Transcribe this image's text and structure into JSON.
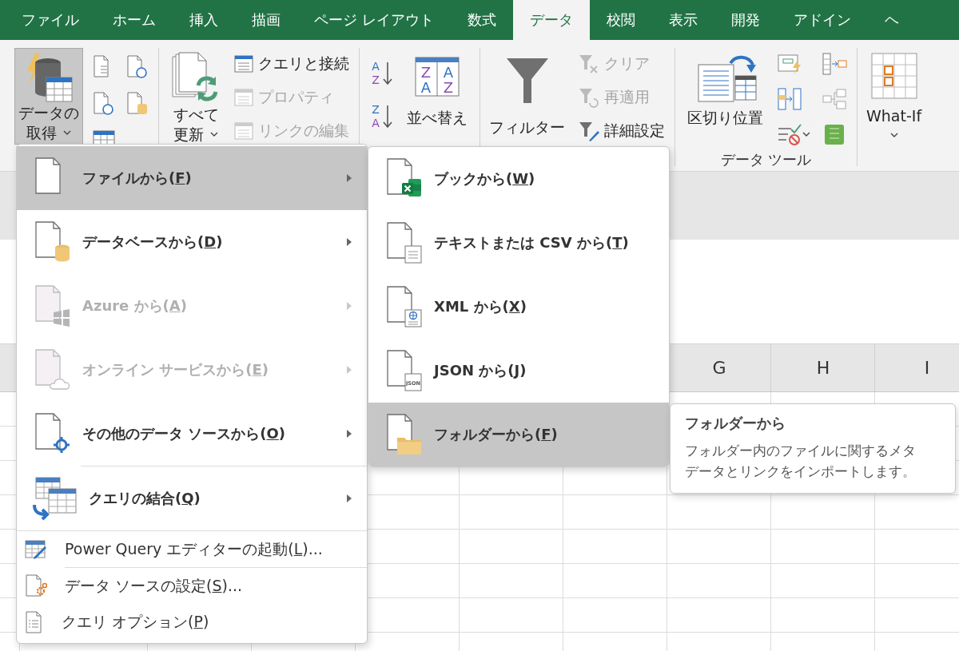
{
  "tabs": [
    {
      "label": "ファイル",
      "selected": false
    },
    {
      "label": "ホーム",
      "selected": false
    },
    {
      "label": "挿入",
      "selected": false
    },
    {
      "label": "描画",
      "selected": false
    },
    {
      "label": "ページ レイアウト",
      "selected": false
    },
    {
      "label": "数式",
      "selected": false
    },
    {
      "label": "データ",
      "selected": true
    },
    {
      "label": "校閲",
      "selected": false
    },
    {
      "label": "表示",
      "selected": false
    },
    {
      "label": "開発",
      "selected": false
    },
    {
      "label": "アドイン",
      "selected": false
    },
    {
      "label": "ヘ",
      "selected": false
    }
  ],
  "ribbon": {
    "get_data": {
      "label_lines": [
        "データの",
        "取得"
      ],
      "pressed": true
    },
    "refresh_all": {
      "label_lines": [
        "すべて",
        "更新"
      ],
      "pressed": false
    },
    "queries": [
      {
        "label": "クエリと接続",
        "disabled": false
      },
      {
        "label": "プロパティ",
        "disabled": true
      },
      {
        "label": "リンクの編集",
        "disabled": true
      }
    ],
    "sort_icons": [
      {
        "top": "A",
        "bottom": "Z"
      },
      {
        "top": "Z",
        "bottom": "A"
      }
    ],
    "sort_grid": [
      "Z",
      "A",
      "A",
      "Z"
    ],
    "sort": {
      "label": "並べ替え"
    },
    "filter": {
      "label": "フィルター"
    },
    "filter_options": [
      {
        "label": "クリア",
        "disabled": true
      },
      {
        "label": "再適用",
        "disabled": true
      },
      {
        "label": "詳細設定",
        "disabled": false
      }
    ],
    "text_to_columns": {
      "label": "区切り位置"
    },
    "data_tools_label": "データ ツール",
    "what_if": {
      "label": "What-If"
    }
  },
  "sheet": {
    "column_headers": [
      "G",
      "H",
      "I"
    ]
  },
  "menu": {
    "items": [
      {
        "kind": "large",
        "text": "ファイルから(",
        "key": "F",
        "after": ")",
        "selected": true,
        "disabled": false,
        "submenu": true
      },
      {
        "kind": "large",
        "text": "データベースから(",
        "key": "D",
        "after": ")",
        "selected": false,
        "disabled": false,
        "submenu": true
      },
      {
        "kind": "large",
        "text": "Azure から(",
        "key": "A",
        "after": ")",
        "selected": false,
        "disabled": true,
        "submenu": true
      },
      {
        "kind": "large",
        "text": "オンライン サービスから(",
        "key": "E",
        "after": ")",
        "selected": false,
        "disabled": true,
        "submenu": true
      },
      {
        "kind": "large",
        "text": "その他のデータ ソースから(",
        "key": "O",
        "after": ")",
        "selected": false,
        "disabled": false,
        "submenu": true
      },
      {
        "kind": "large",
        "text": "クエリの結合(",
        "key": "Q",
        "after": ")",
        "selected": false,
        "disabled": false,
        "submenu": true
      },
      {
        "kind": "small",
        "text": "Power Query エディターの起動(",
        "key": "L",
        "after": ")...",
        "selected": false,
        "disabled": false,
        "submenu": false
      },
      {
        "kind": "small",
        "text": "データ ソースの設定(",
        "key": "S",
        "after": ")...",
        "selected": false,
        "disabled": false,
        "submenu": false
      },
      {
        "kind": "small",
        "text": "クエリ オプション(",
        "key": "P",
        "after": ")",
        "selected": false,
        "disabled": false,
        "submenu": false
      }
    ]
  },
  "submenu": {
    "items": [
      {
        "text": "ブックから(",
        "key": "W",
        "after": ")",
        "selected": false
      },
      {
        "text": "テキストまたは CSV から(",
        "key": "T",
        "after": ")",
        "selected": false
      },
      {
        "text": "XML から(",
        "key": "X",
        "after": ")",
        "selected": false
      },
      {
        "text": "JSON から(",
        "key": "J",
        "after": ")",
        "selected": false,
        "icon_text": "JSON"
      },
      {
        "text": "フォルダーから(",
        "key": "F",
        "after": ")",
        "selected": true
      }
    ]
  },
  "tooltip": {
    "title": "フォルダーから",
    "description": "フォルダー内のファイルに関するメタデータとリンクをインポートします。"
  }
}
